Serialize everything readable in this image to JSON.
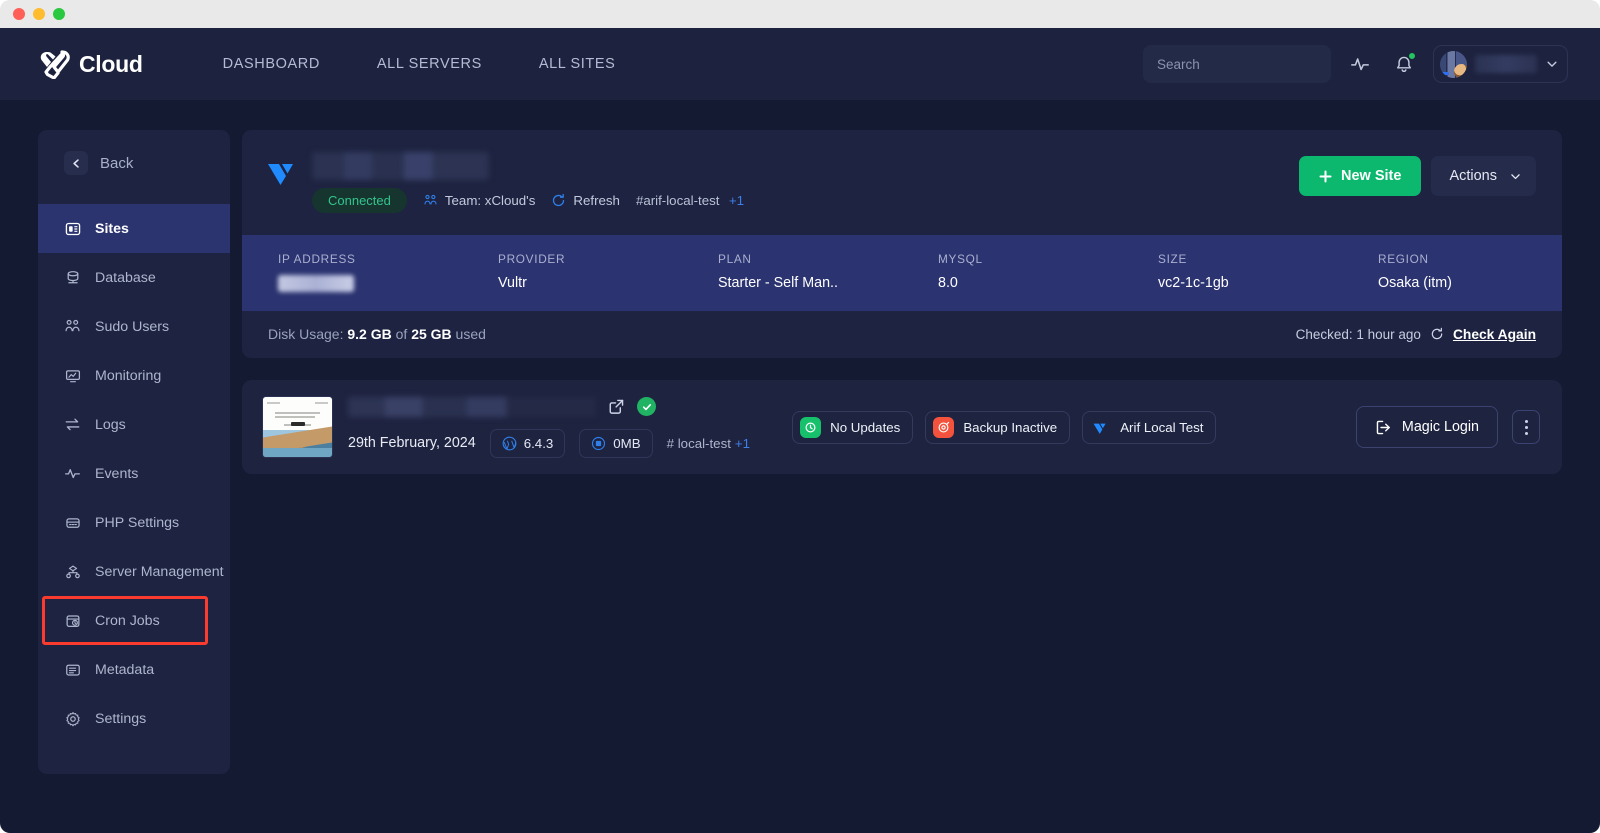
{
  "window": {
    "traffic_lights": [
      "close",
      "minimize",
      "maximize"
    ]
  },
  "topnav": {
    "brand": "Cloud",
    "links": [
      {
        "label": "DASHBOARD"
      },
      {
        "label": "ALL SERVERS"
      },
      {
        "label": "ALL SITES"
      }
    ],
    "search": {
      "value": "",
      "placeholder": "Search"
    },
    "icons": [
      {
        "name": "activity-icon"
      },
      {
        "name": "bell-icon",
        "has_unread": true
      }
    ],
    "profile": {
      "name": "",
      "chevron": "chevron-down-icon"
    }
  },
  "sidebar": {
    "back_label": "Back",
    "items": [
      {
        "label": "Sites",
        "icon": "sites-icon",
        "active": true,
        "highlighted": false
      },
      {
        "label": "Database",
        "icon": "database-icon",
        "active": false,
        "highlighted": false
      },
      {
        "label": "Sudo Users",
        "icon": "users-icon",
        "active": false,
        "highlighted": false
      },
      {
        "label": "Monitoring",
        "icon": "monitor-icon",
        "active": false,
        "highlighted": false
      },
      {
        "label": "Logs",
        "icon": "logs-icon",
        "active": false,
        "highlighted": false
      },
      {
        "label": "Events",
        "icon": "events-icon",
        "active": false,
        "highlighted": false
      },
      {
        "label": "PHP Settings",
        "icon": "php-icon",
        "active": false,
        "highlighted": false
      },
      {
        "label": "Server Management",
        "icon": "server-icon",
        "active": false,
        "highlighted": false
      },
      {
        "label": "Cron Jobs",
        "icon": "cron-icon",
        "active": false,
        "highlighted": true
      },
      {
        "label": "Metadata",
        "icon": "metadata-icon",
        "active": false,
        "highlighted": false
      },
      {
        "label": "Settings",
        "icon": "gear-icon",
        "active": false,
        "highlighted": false
      }
    ]
  },
  "server": {
    "provider_logo": "vultr-logo",
    "name_redacted": true,
    "status": "Connected",
    "team": "Team: xCloud's",
    "refresh": "Refresh",
    "tag": "#arif-local-test",
    "tag_more": "+1",
    "new_site_button": "New Site",
    "actions_button": "Actions",
    "info": [
      {
        "label": "IP ADDRESS",
        "value": "",
        "redacted": true
      },
      {
        "label": "PROVIDER",
        "value": "Vultr",
        "redacted": false
      },
      {
        "label": "PLAN",
        "value": "Starter - Self Man..",
        "redacted": false
      },
      {
        "label": "MYSQL",
        "value": "8.0",
        "redacted": false
      },
      {
        "label": "SIZE",
        "value": "vc2-1c-1gb",
        "redacted": false
      },
      {
        "label": "REGION",
        "value": "Osaka (itm)",
        "redacted": false
      }
    ],
    "disk_usage_prefix": "Disk Usage:",
    "disk_used": "9.2 GB",
    "disk_of": "of",
    "disk_total": "25 GB",
    "disk_suffix": "used",
    "checked_label": "Checked: 1 hour ago",
    "check_again": "Check Again"
  },
  "site_card": {
    "url_redacted": true,
    "external_link_icon": "external-link-icon",
    "status_icon": "check-circle-icon",
    "date": "29th February, 2024",
    "wp_version": "6.4.3",
    "size": "0MB",
    "tag": "# local-test",
    "tag_more": "+1",
    "badges": [
      {
        "label": "No Updates",
        "icon": "update-icon",
        "color": "#17c16b"
      },
      {
        "label": "Backup Inactive",
        "icon": "backup-icon",
        "color": "#f3533d"
      },
      {
        "label": "Arif Local Test",
        "icon": "vultr-icon",
        "color": "#2f6ff0"
      }
    ],
    "magic_login": "Magic Login",
    "kebab": "more-options-icon"
  },
  "colors": {
    "page_bg": "#151a33",
    "panel_bg": "#1d2340",
    "card_bg": "#1e2340",
    "info_strip": "#2b3370",
    "active_nav": "#2c3470",
    "accent_green": "#0bb86d",
    "accent_blue": "#3f7fe8",
    "highlight_red": "#fb3b2e",
    "connected_green": "#31c48d"
  }
}
